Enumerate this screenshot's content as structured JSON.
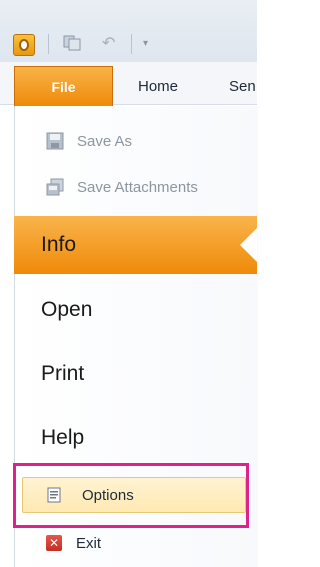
{
  "quick_access": {
    "app_icon": "outlook-app-icon",
    "save_icon": "save-icon",
    "undo_icon": "undo-icon",
    "customize_icon": "customize-toolbar-icon"
  },
  "ribbon": {
    "tabs": [
      {
        "label": "File"
      },
      {
        "label": "Home"
      },
      {
        "label": "Sen"
      }
    ]
  },
  "backstage": {
    "commands": [
      {
        "label": "Save As",
        "icon": "save-as-icon"
      },
      {
        "label": "Save Attachments",
        "icon": "save-attachments-icon"
      }
    ],
    "nav": [
      {
        "label": "Info"
      },
      {
        "label": "Open"
      },
      {
        "label": "Print"
      },
      {
        "label": "Help"
      }
    ],
    "options": {
      "label": "Options",
      "icon": "options-icon"
    },
    "exit": {
      "label": "Exit",
      "icon": "exit-icon"
    }
  },
  "colors": {
    "accent": "#ef8a09",
    "highlight_border": "#e0208b"
  }
}
